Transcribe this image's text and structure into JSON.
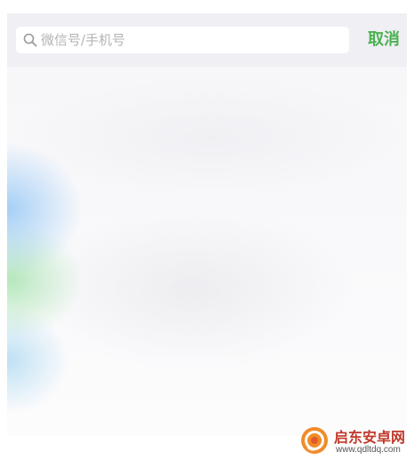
{
  "search": {
    "placeholder": "微信号/手机号",
    "value": "",
    "icon": "search-icon"
  },
  "header": {
    "cancel_label": "取消"
  },
  "watermark": {
    "name": "启东安卓网",
    "url": "www.qdltdq.com",
    "icon": "watermark-logo"
  },
  "colors": {
    "accent": "#4cb050",
    "header_bg": "#efeff4",
    "placeholder": "#b4b4b4",
    "watermark_text": "#c0392b",
    "watermark_logo": "#f08c2a"
  }
}
